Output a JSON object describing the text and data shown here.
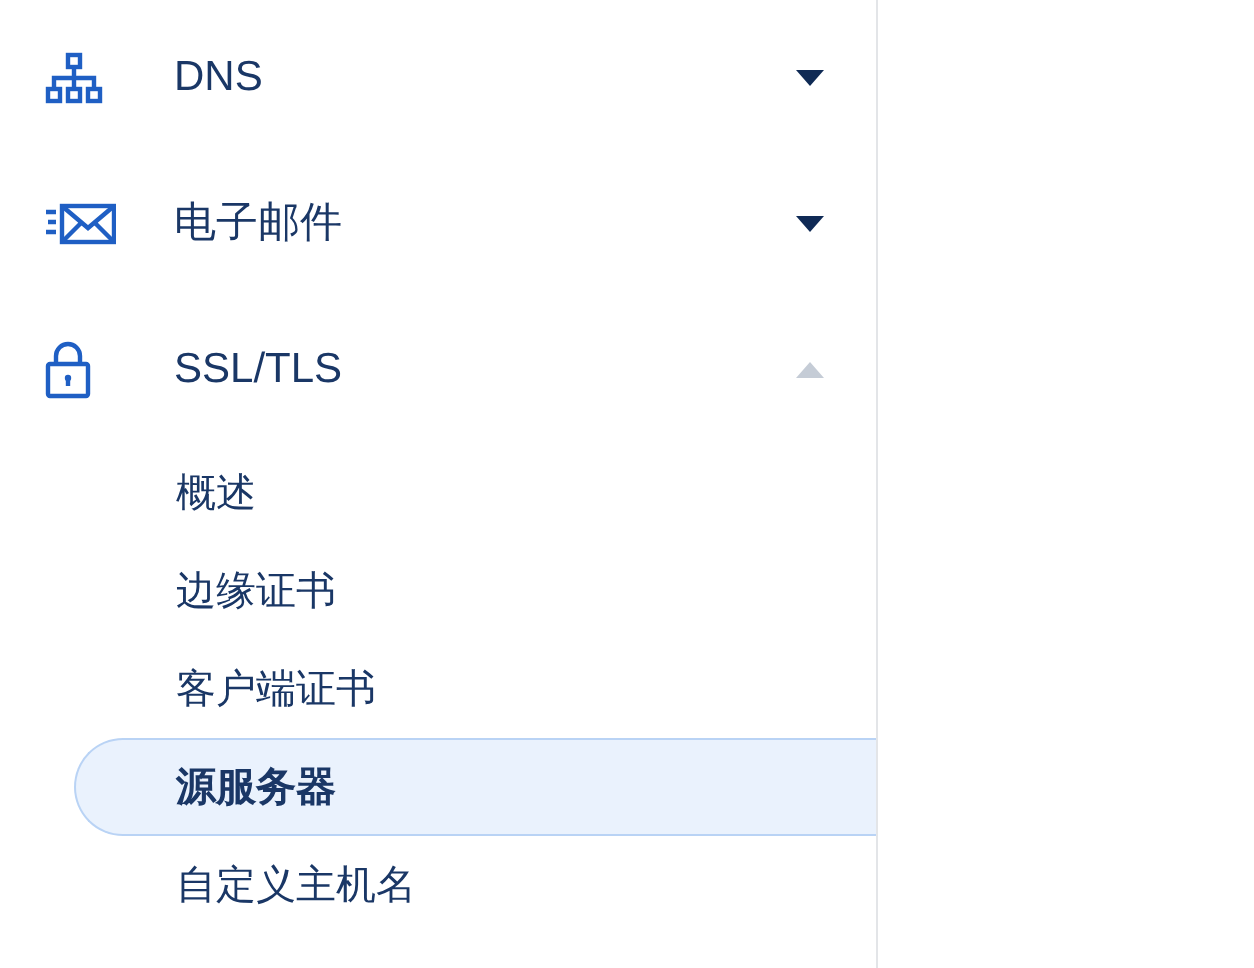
{
  "sidebar": {
    "sections": [
      {
        "kind": "network",
        "label": "DNS",
        "expanded": false
      },
      {
        "kind": "mail",
        "label": "电子邮件",
        "expanded": false
      },
      {
        "kind": "lock",
        "label": "SSL/TLS",
        "expanded": true,
        "children": [
          {
            "label": "概述",
            "selected": false
          },
          {
            "label": "边缘证书",
            "selected": false
          },
          {
            "label": "客户端证书",
            "selected": false
          },
          {
            "label": "源服务器",
            "selected": true
          },
          {
            "label": "自定义主机名",
            "selected": false
          }
        ]
      }
    ]
  }
}
